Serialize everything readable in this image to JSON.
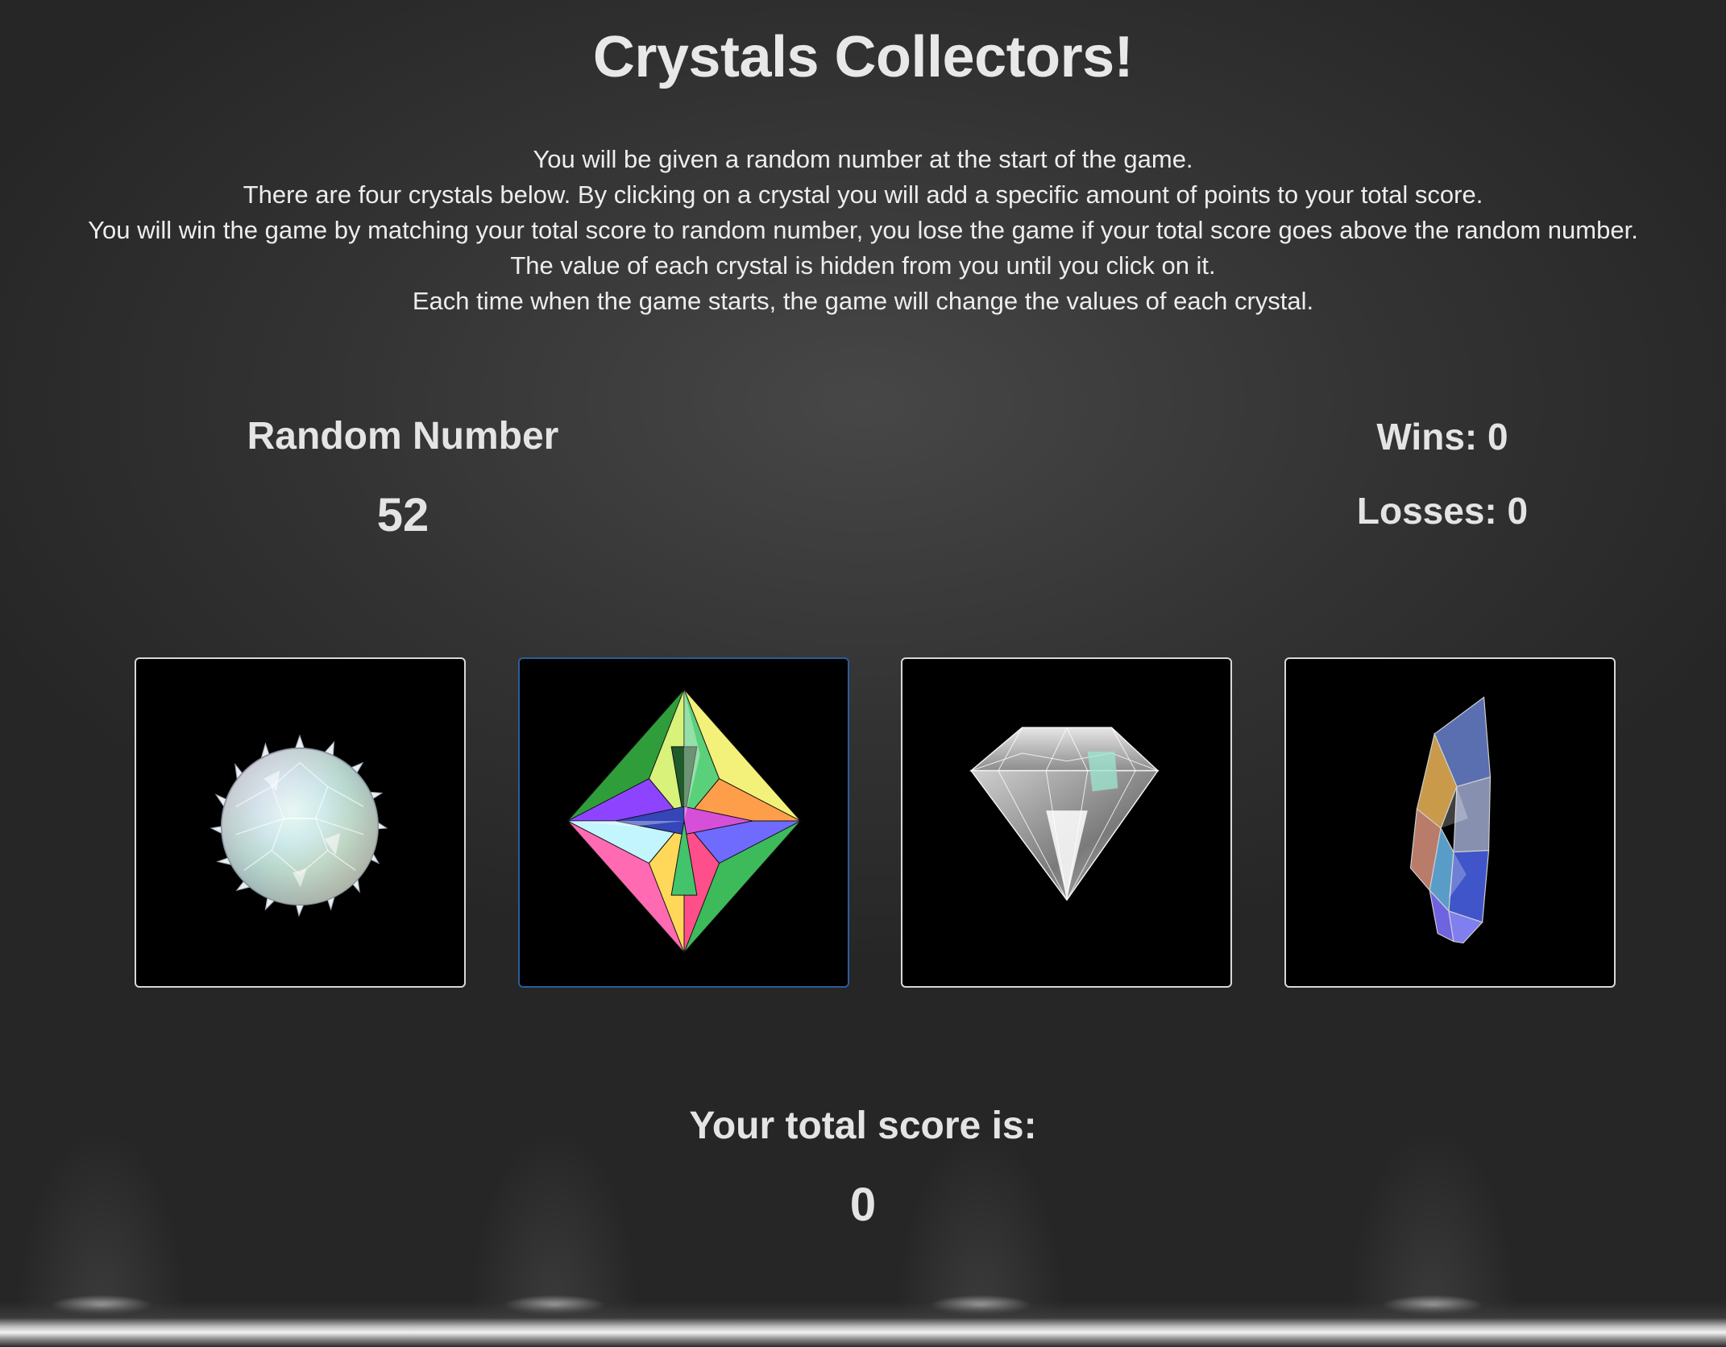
{
  "header": {
    "title": "Crystals Collectors!"
  },
  "instructions": [
    "You will be given a random number at the start of the game.",
    "There are four crystals below. By clicking on a crystal you will add a specific amount of points to your total score.",
    "You will win the game by matching your total score to random number, you lose the game if your total score goes above the random number.",
    "The value of each crystal is hidden from you until you click on it.",
    "Each time when the game starts, the game will change the values of each crystal."
  ],
  "random": {
    "label": "Random Number",
    "value": "52"
  },
  "stats": {
    "wins": "Wins: 0",
    "losses": "Losses: 0"
  },
  "crystals": [
    {
      "icon": "spiky-orb-crystal-icon",
      "selected": false
    },
    {
      "icon": "octahedron-crystal-icon",
      "selected": true
    },
    {
      "icon": "diamond-crystal-icon",
      "selected": false
    },
    {
      "icon": "shard-crystal-icon",
      "selected": false
    }
  ],
  "score": {
    "label": "Your total score is:",
    "value": "0"
  },
  "colors": {
    "text": "#e4e4e4",
    "background": "#333333",
    "card_background": "#000000",
    "card_border": "#d8d8d8",
    "selected_border": "#2a5d9a"
  }
}
